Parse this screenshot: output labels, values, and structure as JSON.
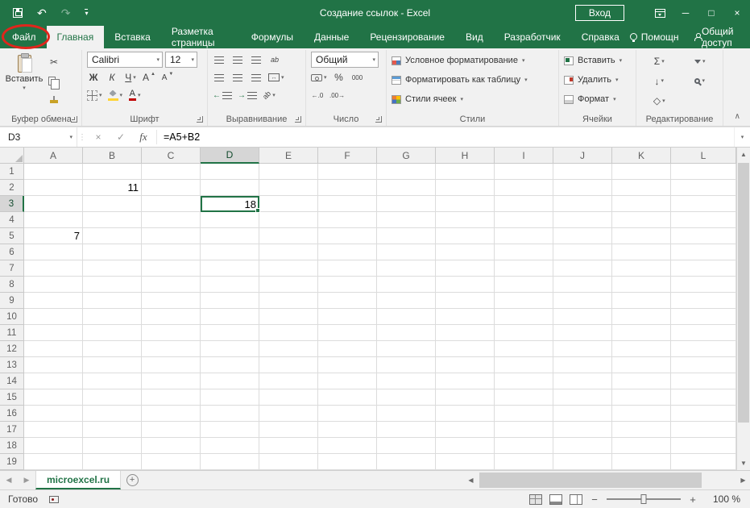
{
  "window": {
    "title": "Создание ссылок  -  Excel",
    "sign_in": "Вход"
  },
  "tabs": [
    "Файл",
    "Главная",
    "Вставка",
    "Разметка страницы",
    "Формулы",
    "Данные",
    "Рецензирование",
    "Вид",
    "Разработчик",
    "Справка"
  ],
  "tab_bar_right": {
    "assistant": "Помощн",
    "share": "Общий доступ"
  },
  "ribbon": {
    "clipboard": {
      "paste": "Вставить",
      "group": "Буфер обмена"
    },
    "font": {
      "family": "Calibri",
      "size": "12",
      "bold": "Ж",
      "italic": "К",
      "underline": "Ч",
      "grow": "А",
      "shrink": "А",
      "color_letter": "А",
      "group": "Шрифт"
    },
    "alignment": {
      "wrap": "ab",
      "orientation": "ab",
      "group": "Выравнивание"
    },
    "number": {
      "format": "Общий",
      "percent": "%",
      "thousands": "000",
      "inc_decimal": "←.0",
      "dec_decimal": ".00→",
      "group": "Число"
    },
    "styles": {
      "conditional": "Условное форматирование",
      "format_table": "Форматировать как таблицу",
      "cell_styles": "Стили ячеек",
      "group": "Стили"
    },
    "cells": {
      "insert": "Вставить",
      "delete": "Удалить",
      "format": "Формат",
      "group": "Ячейки"
    },
    "editing": {
      "group": "Редактирование"
    }
  },
  "formula_bar": {
    "name_box": "D3",
    "cancel": "×",
    "enter": "✓",
    "fx": "fx",
    "formula": "=A5+B2"
  },
  "grid": {
    "columns": [
      "A",
      "B",
      "C",
      "D",
      "E",
      "F",
      "G",
      "H",
      "I",
      "J",
      "K",
      "L"
    ],
    "visible_rows": 19,
    "cells": [
      {
        "ref": "B2",
        "value": "11"
      },
      {
        "ref": "D3",
        "value": "18"
      },
      {
        "ref": "A5",
        "value": "7"
      }
    ],
    "selection": {
      "col": "D",
      "row": 3,
      "ref": "D3"
    }
  },
  "sheet_tabs": {
    "active": "microexcel.ru"
  },
  "status_bar": {
    "ready": "Готово",
    "zoom_out": "−",
    "zoom_in": "+",
    "zoom": "100 %"
  },
  "glyphs": {
    "dd": "▾",
    "undo": "↶",
    "redo": "↷",
    "scissors": "✂",
    "sum": "Σ",
    "fill_down": "↓",
    "clear": "◇",
    "collapse": "∧",
    "minimize": "─",
    "maximize": "□",
    "close": "×",
    "left": "◀",
    "right": "▶",
    "up": "▲",
    "down": "▼",
    "splitter": "⋮",
    "plus": "+",
    "merge": "↔",
    "indent_l": "←",
    "indent_r": "→"
  },
  "colors": {
    "excel_green": "#217346",
    "annotation_red": "#e0261c"
  }
}
